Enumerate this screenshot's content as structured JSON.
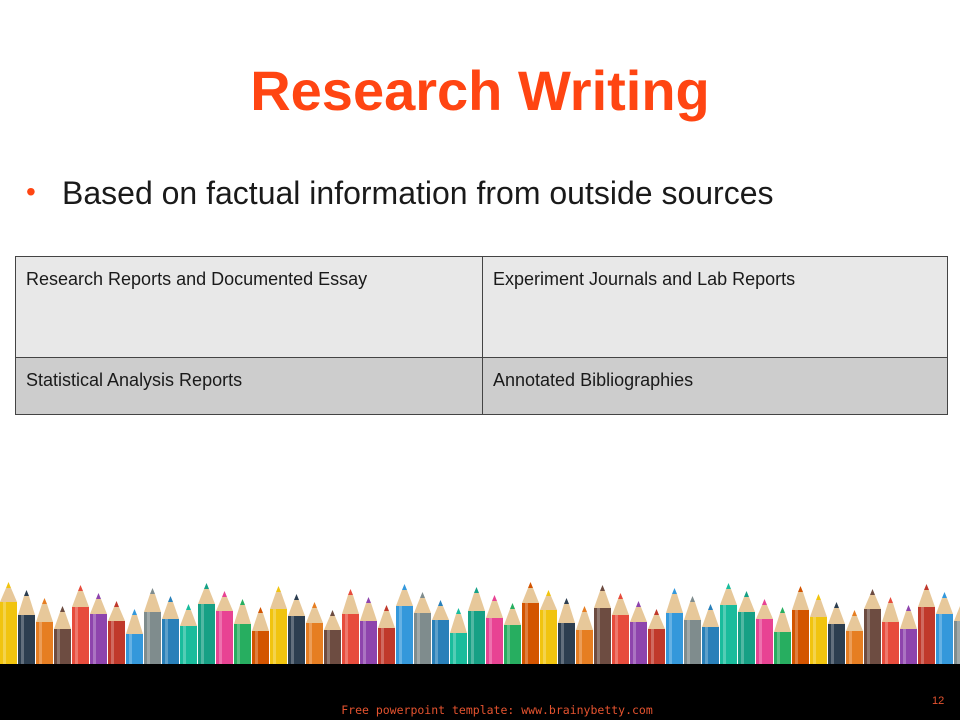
{
  "slide": {
    "title": "Research Writing",
    "bullet": "Based on factual information from outside sources",
    "table": {
      "rows": [
        [
          "Research Reports and Documented Essay",
          "Experiment Journals and Lab Reports"
        ],
        [
          "Statistical Analysis Reports",
          "Annotated Bibliographies"
        ]
      ]
    },
    "footer_text": "Free powerpoint template: www.brainybetty.com",
    "page_number": "12"
  },
  "colors": {
    "title": "#ff4512",
    "bullet_dot": "#ff4512",
    "footer_bg": "#000000",
    "footer_text": "#e5532f",
    "row1_bg": "#e8e8e8",
    "row2_bg": "#cdcdcd"
  },
  "decoration": {
    "pencil_colors": [
      "#c0392b",
      "#e74c3c",
      "#e67e22",
      "#f1c40f",
      "#27ae60",
      "#16a085",
      "#2980b9",
      "#3498db",
      "#8e44ad",
      "#6d4c41",
      "#2c3e50",
      "#d35400",
      "#e84393",
      "#1abc9c",
      "#7f8c8d"
    ]
  }
}
